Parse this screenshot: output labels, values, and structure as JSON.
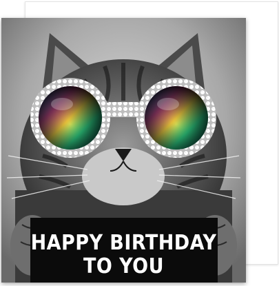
{
  "card": {
    "message_line_1": "HAPPY BIRTHDAY",
    "message_line_2": "TO YOU"
  },
  "colors": {
    "background": "#ffffff",
    "banner": "#0b0b0b",
    "text": "#ffffff",
    "lens_tint": [
      "#ff4fa0",
      "#ffd23f",
      "#35e08a",
      "#3aa0ff"
    ]
  }
}
